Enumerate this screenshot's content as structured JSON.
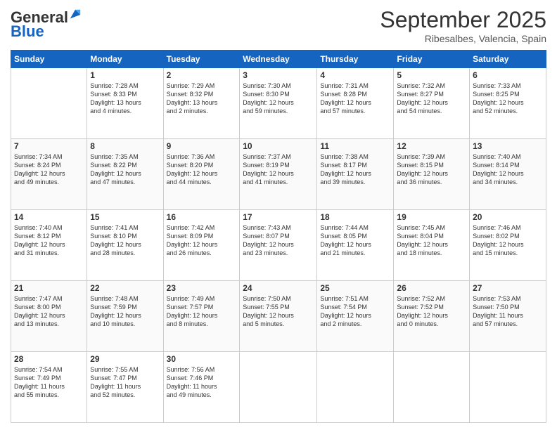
{
  "header": {
    "logo_line1": "General",
    "logo_line2": "Blue",
    "month": "September 2025",
    "location": "Ribesalbes, Valencia, Spain"
  },
  "days_of_week": [
    "Sunday",
    "Monday",
    "Tuesday",
    "Wednesday",
    "Thursday",
    "Friday",
    "Saturday"
  ],
  "weeks": [
    [
      {
        "day": "",
        "content": ""
      },
      {
        "day": "1",
        "content": "Sunrise: 7:28 AM\nSunset: 8:33 PM\nDaylight: 13 hours\nand 4 minutes."
      },
      {
        "day": "2",
        "content": "Sunrise: 7:29 AM\nSunset: 8:32 PM\nDaylight: 13 hours\nand 2 minutes."
      },
      {
        "day": "3",
        "content": "Sunrise: 7:30 AM\nSunset: 8:30 PM\nDaylight: 12 hours\nand 59 minutes."
      },
      {
        "day": "4",
        "content": "Sunrise: 7:31 AM\nSunset: 8:28 PM\nDaylight: 12 hours\nand 57 minutes."
      },
      {
        "day": "5",
        "content": "Sunrise: 7:32 AM\nSunset: 8:27 PM\nDaylight: 12 hours\nand 54 minutes."
      },
      {
        "day": "6",
        "content": "Sunrise: 7:33 AM\nSunset: 8:25 PM\nDaylight: 12 hours\nand 52 minutes."
      }
    ],
    [
      {
        "day": "7",
        "content": "Sunrise: 7:34 AM\nSunset: 8:24 PM\nDaylight: 12 hours\nand 49 minutes."
      },
      {
        "day": "8",
        "content": "Sunrise: 7:35 AM\nSunset: 8:22 PM\nDaylight: 12 hours\nand 47 minutes."
      },
      {
        "day": "9",
        "content": "Sunrise: 7:36 AM\nSunset: 8:20 PM\nDaylight: 12 hours\nand 44 minutes."
      },
      {
        "day": "10",
        "content": "Sunrise: 7:37 AM\nSunset: 8:19 PM\nDaylight: 12 hours\nand 41 minutes."
      },
      {
        "day": "11",
        "content": "Sunrise: 7:38 AM\nSunset: 8:17 PM\nDaylight: 12 hours\nand 39 minutes."
      },
      {
        "day": "12",
        "content": "Sunrise: 7:39 AM\nSunset: 8:15 PM\nDaylight: 12 hours\nand 36 minutes."
      },
      {
        "day": "13",
        "content": "Sunrise: 7:40 AM\nSunset: 8:14 PM\nDaylight: 12 hours\nand 34 minutes."
      }
    ],
    [
      {
        "day": "14",
        "content": "Sunrise: 7:40 AM\nSunset: 8:12 PM\nDaylight: 12 hours\nand 31 minutes."
      },
      {
        "day": "15",
        "content": "Sunrise: 7:41 AM\nSunset: 8:10 PM\nDaylight: 12 hours\nand 28 minutes."
      },
      {
        "day": "16",
        "content": "Sunrise: 7:42 AM\nSunset: 8:09 PM\nDaylight: 12 hours\nand 26 minutes."
      },
      {
        "day": "17",
        "content": "Sunrise: 7:43 AM\nSunset: 8:07 PM\nDaylight: 12 hours\nand 23 minutes."
      },
      {
        "day": "18",
        "content": "Sunrise: 7:44 AM\nSunset: 8:05 PM\nDaylight: 12 hours\nand 21 minutes."
      },
      {
        "day": "19",
        "content": "Sunrise: 7:45 AM\nSunset: 8:04 PM\nDaylight: 12 hours\nand 18 minutes."
      },
      {
        "day": "20",
        "content": "Sunrise: 7:46 AM\nSunset: 8:02 PM\nDaylight: 12 hours\nand 15 minutes."
      }
    ],
    [
      {
        "day": "21",
        "content": "Sunrise: 7:47 AM\nSunset: 8:00 PM\nDaylight: 12 hours\nand 13 minutes."
      },
      {
        "day": "22",
        "content": "Sunrise: 7:48 AM\nSunset: 7:59 PM\nDaylight: 12 hours\nand 10 minutes."
      },
      {
        "day": "23",
        "content": "Sunrise: 7:49 AM\nSunset: 7:57 PM\nDaylight: 12 hours\nand 8 minutes."
      },
      {
        "day": "24",
        "content": "Sunrise: 7:50 AM\nSunset: 7:55 PM\nDaylight: 12 hours\nand 5 minutes."
      },
      {
        "day": "25",
        "content": "Sunrise: 7:51 AM\nSunset: 7:54 PM\nDaylight: 12 hours\nand 2 minutes."
      },
      {
        "day": "26",
        "content": "Sunrise: 7:52 AM\nSunset: 7:52 PM\nDaylight: 12 hours\nand 0 minutes."
      },
      {
        "day": "27",
        "content": "Sunrise: 7:53 AM\nSunset: 7:50 PM\nDaylight: 11 hours\nand 57 minutes."
      }
    ],
    [
      {
        "day": "28",
        "content": "Sunrise: 7:54 AM\nSunset: 7:49 PM\nDaylight: 11 hours\nand 55 minutes."
      },
      {
        "day": "29",
        "content": "Sunrise: 7:55 AM\nSunset: 7:47 PM\nDaylight: 11 hours\nand 52 minutes."
      },
      {
        "day": "30",
        "content": "Sunrise: 7:56 AM\nSunset: 7:46 PM\nDaylight: 11 hours\nand 49 minutes."
      },
      {
        "day": "",
        "content": ""
      },
      {
        "day": "",
        "content": ""
      },
      {
        "day": "",
        "content": ""
      },
      {
        "day": "",
        "content": ""
      }
    ]
  ]
}
